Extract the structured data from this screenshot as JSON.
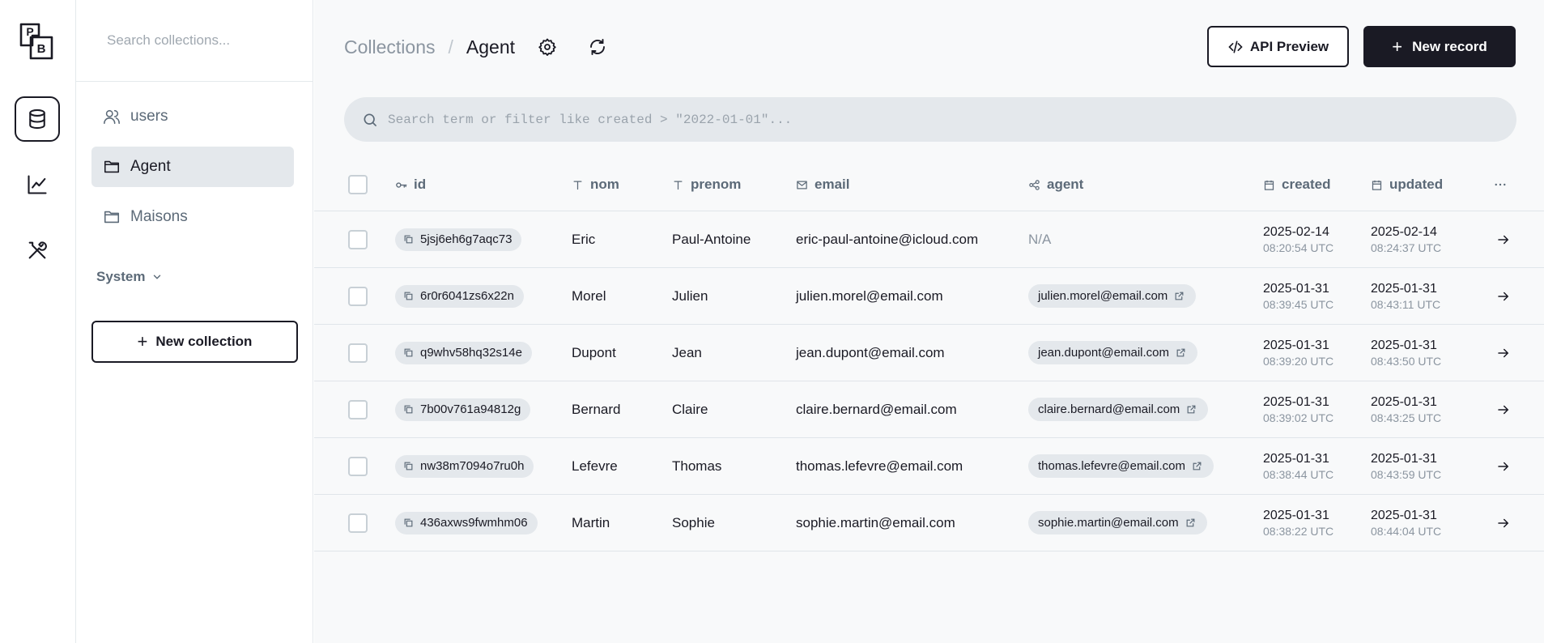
{
  "sidebar": {
    "search_placeholder": "Search collections...",
    "items": [
      {
        "label": "users",
        "icon": "users-icon"
      },
      {
        "label": "Agent",
        "icon": "folder-icon"
      },
      {
        "label": "Maisons",
        "icon": "folder-icon"
      }
    ],
    "system_label": "System",
    "new_collection_label": "New collection"
  },
  "header": {
    "breadcrumb_root": "Collections",
    "breadcrumb_separator": "/",
    "breadcrumb_current": "Agent",
    "api_preview_label": "API Preview",
    "new_record_label": "New record"
  },
  "filter": {
    "placeholder": "Search term or filter like created > \"2022-01-01\"..."
  },
  "table": {
    "columns": {
      "id": "id",
      "nom": "nom",
      "prenom": "prenom",
      "email": "email",
      "agent": "agent",
      "created": "created",
      "updated": "updated"
    },
    "rows": [
      {
        "id": "5jsj6eh6g7aqc73",
        "nom": "Eric",
        "prenom": "Paul-Antoine",
        "email": "eric-paul-antoine@icloud.com",
        "agent": "N/A",
        "created_date": "2025-02-14",
        "created_time": "08:20:54 UTC",
        "updated_date": "2025-02-14",
        "updated_time": "08:24:37 UTC"
      },
      {
        "id": "6r0r6041zs6x22n",
        "nom": "Morel",
        "prenom": "Julien",
        "email": "julien.morel@email.com",
        "agent": "julien.morel@email.com",
        "created_date": "2025-01-31",
        "created_time": "08:39:45 UTC",
        "updated_date": "2025-01-31",
        "updated_time": "08:43:11 UTC"
      },
      {
        "id": "q9whv58hq32s14e",
        "nom": "Dupont",
        "prenom": "Jean",
        "email": "jean.dupont@email.com",
        "agent": "jean.dupont@email.com",
        "created_date": "2025-01-31",
        "created_time": "08:39:20 UTC",
        "updated_date": "2025-01-31",
        "updated_time": "08:43:50 UTC"
      },
      {
        "id": "7b00v761a94812g",
        "nom": "Bernard",
        "prenom": "Claire",
        "email": "claire.bernard@email.com",
        "agent": "claire.bernard@email.com",
        "created_date": "2025-01-31",
        "created_time": "08:39:02 UTC",
        "updated_date": "2025-01-31",
        "updated_time": "08:43:25 UTC"
      },
      {
        "id": "nw38m7094o7ru0h",
        "nom": "Lefevre",
        "prenom": "Thomas",
        "email": "thomas.lefevre@email.com",
        "agent": "thomas.lefevre@email.com",
        "created_date": "2025-01-31",
        "created_time": "08:38:44 UTC",
        "updated_date": "2025-01-31",
        "updated_time": "08:43:59 UTC"
      },
      {
        "id": "436axws9fwmhm06",
        "nom": "Martin",
        "prenom": "Sophie",
        "email": "sophie.martin@email.com",
        "agent": "sophie.martin@email.com",
        "created_date": "2025-01-31",
        "created_time": "08:38:22 UTC",
        "updated_date": "2025-01-31",
        "updated_time": "08:44:04 UTC"
      }
    ]
  },
  "colors": {
    "primary_dark": "#1a1a24",
    "muted_text": "#5c6a78",
    "chip_bg": "#e4e8ec",
    "main_bg": "#f8f9fa"
  }
}
